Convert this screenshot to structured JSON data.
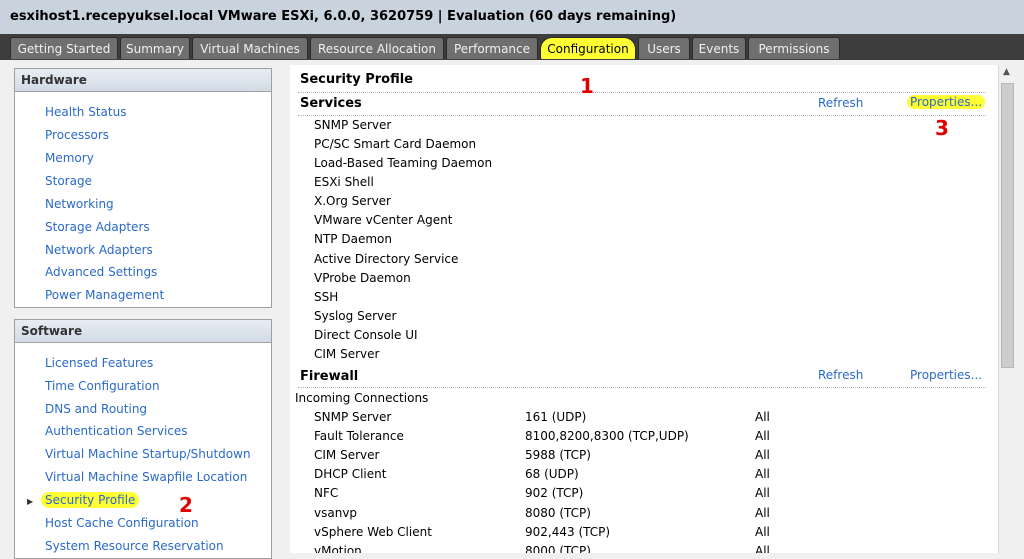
{
  "window": {
    "title": "esxihost1.recepyuksel.local VMware ESXi, 6.0.0, 3620759 | Evaluation (60 days remaining)"
  },
  "tabs": [
    {
      "label": "Getting Started"
    },
    {
      "label": "Summary"
    },
    {
      "label": "Virtual Machines"
    },
    {
      "label": "Resource Allocation"
    },
    {
      "label": "Performance"
    },
    {
      "label": "Configuration"
    },
    {
      "label": "Users"
    },
    {
      "label": "Events"
    },
    {
      "label": "Permissions"
    }
  ],
  "active_tab": "Configuration",
  "hardware": {
    "header": "Hardware",
    "items": [
      "Health Status",
      "Processors",
      "Memory",
      "Storage",
      "Networking",
      "Storage Adapters",
      "Network Adapters",
      "Advanced Settings",
      "Power Management"
    ]
  },
  "software": {
    "header": "Software",
    "items": [
      "Licensed Features",
      "Time Configuration",
      "DNS and Routing",
      "Authentication Services",
      "Virtual Machine Startup/Shutdown",
      "Virtual Machine Swapfile Location",
      "Security Profile",
      "Host Cache Configuration",
      "System Resource Reservation"
    ],
    "selected": "Security Profile"
  },
  "main": {
    "title": "Security Profile",
    "services": {
      "label": "Services",
      "refresh": "Refresh",
      "properties": "Properties...",
      "items": [
        "SNMP Server",
        "PC/SC Smart Card Daemon",
        "Load-Based Teaming Daemon",
        "ESXi Shell",
        "X.Org Server",
        "VMware vCenter Agent",
        "NTP Daemon",
        "Active Directory Service",
        "VProbe Daemon",
        "SSH",
        "Syslog Server",
        "Direct Console UI",
        "CIM Server"
      ]
    },
    "firewall": {
      "label": "Firewall",
      "refresh": "Refresh",
      "properties": "Properties...",
      "incoming_label": "Incoming Connections",
      "rows": [
        {
          "name": "SNMP Server",
          "ports": "161 (UDP)",
          "scope": "All"
        },
        {
          "name": "Fault Tolerance",
          "ports": "8100,8200,8300 (TCP,UDP)",
          "scope": "All"
        },
        {
          "name": "CIM Server",
          "ports": "5988 (TCP)",
          "scope": "All"
        },
        {
          "name": "DHCP Client",
          "ports": "68 (UDP)",
          "scope": "All"
        },
        {
          "name": "NFC",
          "ports": "902 (TCP)",
          "scope": "All"
        },
        {
          "name": "vsanvp",
          "ports": "8080 (TCP)",
          "scope": "All"
        },
        {
          "name": "vSphere Web Client",
          "ports": "902,443 (TCP)",
          "scope": "All"
        },
        {
          "name": "vMotion",
          "ports": "8000 (TCP)",
          "scope": "All"
        }
      ]
    }
  },
  "annotations": [
    "1",
    "2",
    "3"
  ],
  "colors": {
    "highlight": "#ffff33",
    "link": "#2a6ac8",
    "annotation": "#e00000"
  }
}
